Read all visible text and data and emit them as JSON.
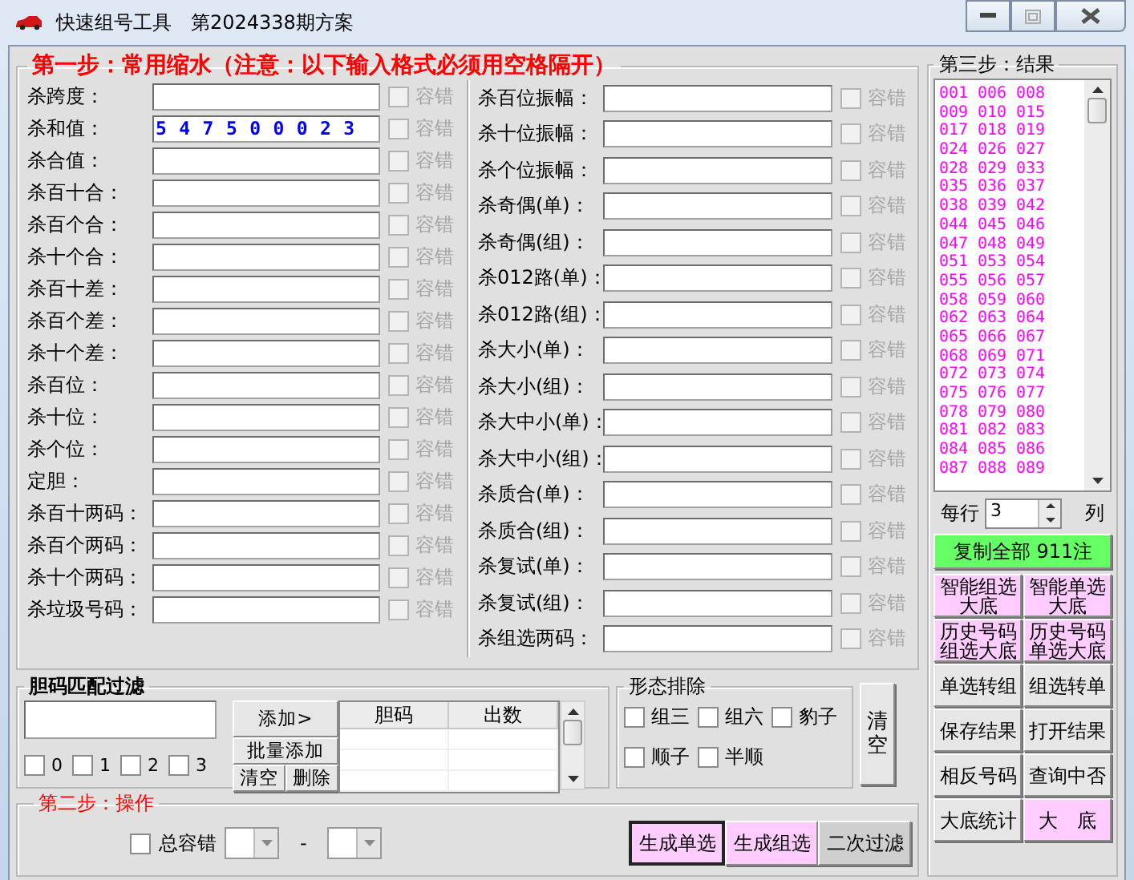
{
  "window": {
    "title": "快速组号工具　第2024338期方案"
  },
  "step1": {
    "title": "第一步：常用缩水（注意：以下输入格式必须用空格隔开）",
    "left_fields": [
      {
        "label": "杀跨度：",
        "tolerance": "容错",
        "checked": false,
        "disabled": true
      },
      {
        "label": "杀和值：",
        "value": "5 4 7 5 0 0 0 2 3",
        "tolerance": "容错",
        "checked": false,
        "disabled": true
      },
      {
        "label": "杀合值：",
        "tolerance": "容错",
        "checked": false,
        "disabled": true
      },
      {
        "label": "杀百十合：",
        "tolerance": "容错",
        "checked": false,
        "disabled": true
      },
      {
        "label": "杀百个合：",
        "tolerance": "容错",
        "checked": false,
        "disabled": true
      },
      {
        "label": "杀十个合：",
        "tolerance": "容错",
        "checked": false,
        "disabled": true
      },
      {
        "label": "杀百十差：",
        "tolerance": "容错",
        "checked": false,
        "disabled": true
      },
      {
        "label": "杀百个差：",
        "tolerance": "容错",
        "checked": false,
        "disabled": true
      },
      {
        "label": "杀十个差：",
        "tolerance": "容错",
        "checked": false,
        "disabled": true
      },
      {
        "label": "杀百位：",
        "tolerance": "容错",
        "checked": false,
        "disabled": true
      },
      {
        "label": "杀十位：",
        "tolerance": "容错",
        "checked": false,
        "disabled": true
      },
      {
        "label": "杀个位：",
        "tolerance": "容错",
        "checked": false,
        "disabled": true
      },
      {
        "label": "定胆：",
        "tolerance": "容错",
        "checked": false,
        "disabled": true
      },
      {
        "label": "杀百十两码：",
        "tolerance": "容错",
        "checked": false,
        "disabled": true
      },
      {
        "label": "杀百个两码：",
        "tolerance": "容错",
        "checked": false,
        "disabled": true
      },
      {
        "label": "杀十个两码：",
        "tolerance": "容错",
        "checked": false,
        "disabled": true
      },
      {
        "label": "杀垃圾号码：",
        "tolerance": "容错",
        "checked": false,
        "disabled": true
      }
    ],
    "right_fields": [
      {
        "label": "杀百位振幅：",
        "tolerance": "容错",
        "checked": false,
        "disabled": true
      },
      {
        "label": "杀十位振幅：",
        "tolerance": "容错",
        "checked": false,
        "disabled": true
      },
      {
        "label": "杀个位振幅：",
        "tolerance": "容错",
        "checked": false,
        "disabled": true
      },
      {
        "label": "杀奇偶(单)：",
        "tolerance": "容错",
        "checked": false,
        "disabled": true
      },
      {
        "label": "杀奇偶(组)：",
        "tolerance": "容错",
        "checked": false,
        "disabled": true
      },
      {
        "label": "杀012路(单)：",
        "tolerance": "容错",
        "checked": false,
        "disabled": true
      },
      {
        "label": "杀012路(组)：",
        "tolerance": "容错",
        "checked": false,
        "disabled": true
      },
      {
        "label": "杀大小(单)：",
        "tolerance": "容错",
        "checked": false,
        "disabled": true
      },
      {
        "label": "杀大小(组)：",
        "tolerance": "容错",
        "checked": false,
        "disabled": true
      },
      {
        "label": "杀大中小(单)：",
        "tolerance": "容错",
        "checked": false,
        "disabled": true
      },
      {
        "label": "杀大中小(组)：",
        "tolerance": "容错",
        "checked": false,
        "disabled": true
      },
      {
        "label": "杀质合(单)：",
        "tolerance": "容错",
        "checked": false,
        "disabled": true
      },
      {
        "label": "杀质合(组)：",
        "tolerance": "容错",
        "checked": false,
        "disabled": true
      },
      {
        "label": "杀复试(单)：",
        "tolerance": "容错",
        "checked": false,
        "disabled": true
      },
      {
        "label": "杀复试(组)：",
        "tolerance": "容错",
        "checked": false,
        "disabled": true
      },
      {
        "label": "杀组选两码：",
        "tolerance": "容错",
        "checked": false,
        "disabled": true
      }
    ]
  },
  "filter": {
    "title": "胆码匹配过滤",
    "add_button": "添加>",
    "batch_button": "批量添加",
    "clear_button": "清空",
    "delete_button": "删除",
    "counts": [
      {
        "label": "0",
        "checked": false
      },
      {
        "label": "1",
        "checked": false
      },
      {
        "label": "2",
        "checked": false
      },
      {
        "label": "3",
        "checked": false
      }
    ],
    "table": {
      "columns": [
        "胆码",
        "出数"
      ]
    }
  },
  "shape": {
    "title": "形态排除",
    "options": [
      {
        "label": "组三",
        "checked": false
      },
      {
        "label": "组六",
        "checked": false
      },
      {
        "label": "豹子",
        "checked": false
      },
      {
        "label": "顺子",
        "checked": false
      },
      {
        "label": "半顺",
        "checked": false
      }
    ],
    "clear_button": "清空"
  },
  "step2": {
    "title": "第二步：操作",
    "total_tolerance": {
      "label": "总容错",
      "checked": false
    },
    "separator": "-",
    "buttons": [
      {
        "label": "生成单选",
        "highlighted": true
      },
      {
        "label": "生成组选",
        "highlighted": true
      },
      {
        "label": "二次过滤",
        "highlighted": false
      }
    ]
  },
  "results": {
    "title": "第三步：结果",
    "numbers": [
      "001",
      "006",
      "008",
      "009",
      "010",
      "015",
      "017",
      "018",
      "019",
      "024",
      "026",
      "027",
      "028",
      "029",
      "033",
      "035",
      "036",
      "037",
      "038",
      "039",
      "042",
      "044",
      "045",
      "046",
      "047",
      "048",
      "049",
      "051",
      "053",
      "054",
      "055",
      "056",
      "057",
      "058",
      "059",
      "060",
      "062",
      "063",
      "064",
      "065",
      "066",
      "067",
      "068",
      "069",
      "071",
      "072",
      "073",
      "074",
      "075",
      "076",
      "077",
      "078",
      "079",
      "080",
      "081",
      "082",
      "083",
      "084",
      "085",
      "086",
      "087",
      "088",
      "089"
    ],
    "per_row_label": "每行",
    "per_row_value": "3",
    "columns_label": "列",
    "copy_button": "复制全部 911注",
    "buttons": [
      {
        "label": "智能组选大底",
        "highlighted": true
      },
      {
        "label": "智能单选大底",
        "highlighted": true
      },
      {
        "label": "历史号码组选大底",
        "highlighted": true
      },
      {
        "label": "历史号码单选大底",
        "highlighted": true
      },
      {
        "label": "单选转组",
        "highlighted": false
      },
      {
        "label": "组选转单",
        "highlighted": false
      },
      {
        "label": "保存结果",
        "highlighted": false
      },
      {
        "label": "打开结果",
        "highlighted": false
      },
      {
        "label": "相反号码",
        "highlighted": false
      },
      {
        "label": "查询中否",
        "highlighted": false
      },
      {
        "label": "大底统计",
        "highlighted": false
      },
      {
        "label": "大　底",
        "highlighted": true
      }
    ]
  }
}
